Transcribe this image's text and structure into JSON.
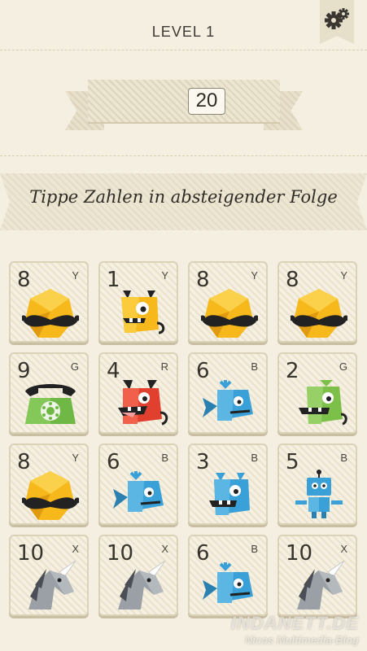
{
  "header": {
    "level_label": "LEVEL 1",
    "settings_icon": "gears-icon"
  },
  "score": {
    "value": "20"
  },
  "instruction": {
    "text": "Tippe Zahlen in absteigender Folge"
  },
  "tiles": [
    {
      "number": "8",
      "letter": "Y",
      "creature": "mustache-gem"
    },
    {
      "number": "1",
      "letter": "Y",
      "creature": "yellow-monster"
    },
    {
      "number": "8",
      "letter": "Y",
      "creature": "mustache-gem"
    },
    {
      "number": "8",
      "letter": "Y",
      "creature": "mustache-gem"
    },
    {
      "number": "9",
      "letter": "G",
      "creature": "green-telephone"
    },
    {
      "number": "4",
      "letter": "R",
      "creature": "red-devil"
    },
    {
      "number": "6",
      "letter": "B",
      "creature": "blue-whale"
    },
    {
      "number": "2",
      "letter": "G",
      "creature": "green-monster"
    },
    {
      "number": "8",
      "letter": "Y",
      "creature": "mustache-gem"
    },
    {
      "number": "6",
      "letter": "B",
      "creature": "blue-whale"
    },
    {
      "number": "3",
      "letter": "B",
      "creature": "blue-monster"
    },
    {
      "number": "5",
      "letter": "B",
      "creature": "blue-robot"
    },
    {
      "number": "10",
      "letter": "X",
      "creature": "grey-unicorn"
    },
    {
      "number": "10",
      "letter": "X",
      "creature": "grey-unicorn"
    },
    {
      "number": "6",
      "letter": "B",
      "creature": "blue-whale"
    },
    {
      "number": "10",
      "letter": "X",
      "creature": "grey-unicorn"
    }
  ],
  "watermark": {
    "line1": "INDANETT.DE",
    "line2": "Nicos Multimedia-Blog"
  },
  "colors": {
    "background": "#f4efe0",
    "yellow": "#f6b81a",
    "blue": "#3aa0d8",
    "red": "#e2402e",
    "green": "#7cc04a",
    "grey": "#9aa0a6"
  }
}
